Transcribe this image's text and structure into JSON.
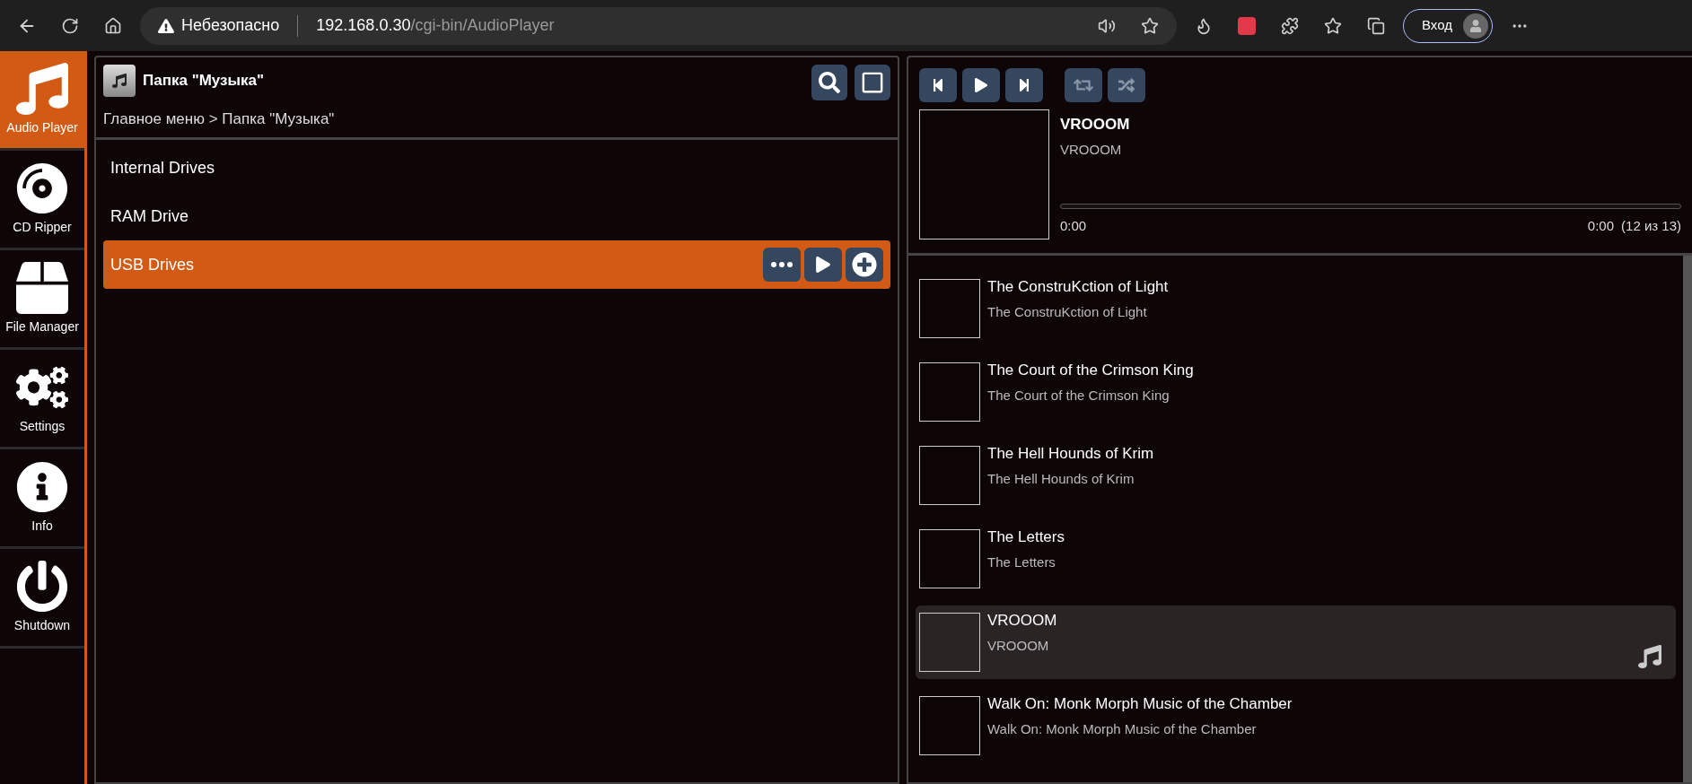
{
  "browser": {
    "security_label": "Небезопасно",
    "url_host": "192.168.0.30",
    "url_path": "/cgi-bin/AudioPlayer",
    "signin_label": "Вход"
  },
  "nav": [
    {
      "label": "Audio Player",
      "kind": "music",
      "selected": true
    },
    {
      "label": "CD Ripper",
      "kind": "disc",
      "selected": false
    },
    {
      "label": "File Manager",
      "kind": "box",
      "selected": false
    },
    {
      "label": "Settings",
      "kind": "gears",
      "selected": false
    },
    {
      "label": "Info",
      "kind": "info",
      "selected": false
    },
    {
      "label": "Shutdown",
      "kind": "power",
      "selected": false
    }
  ],
  "folder": {
    "title": "Папка \"Музыка\"",
    "breadcrumb": "Главное меню > Папка \"Музыка\"",
    "items": [
      {
        "label": "Internal Drives",
        "selected": false
      },
      {
        "label": "RAM Drive",
        "selected": false
      },
      {
        "label": "USB Drives",
        "selected": true
      }
    ]
  },
  "player": {
    "title": "VROOOM",
    "album": "VROOOM",
    "elapsed": "0:00",
    "remaining": "0:00",
    "position": "(12 из 13)",
    "repeat": false,
    "shuffle": false
  },
  "tracks": [
    {
      "title": "The ConstruKction of Light",
      "album": "The ConstruKction of Light",
      "selected": false
    },
    {
      "title": "The Court of the Crimson King",
      "album": "The Court of the Crimson King",
      "selected": false
    },
    {
      "title": "The Hell Hounds of Krim",
      "album": "The Hell Hounds of Krim",
      "selected": false
    },
    {
      "title": "The Letters",
      "album": "The Letters",
      "selected": false
    },
    {
      "title": "VROOOM",
      "album": "VROOOM",
      "selected": true
    },
    {
      "title": "Walk On: Monk Morph Music of the Chamber",
      "album": "Walk On: Monk Morph Music of the Chamber",
      "selected": false
    }
  ]
}
